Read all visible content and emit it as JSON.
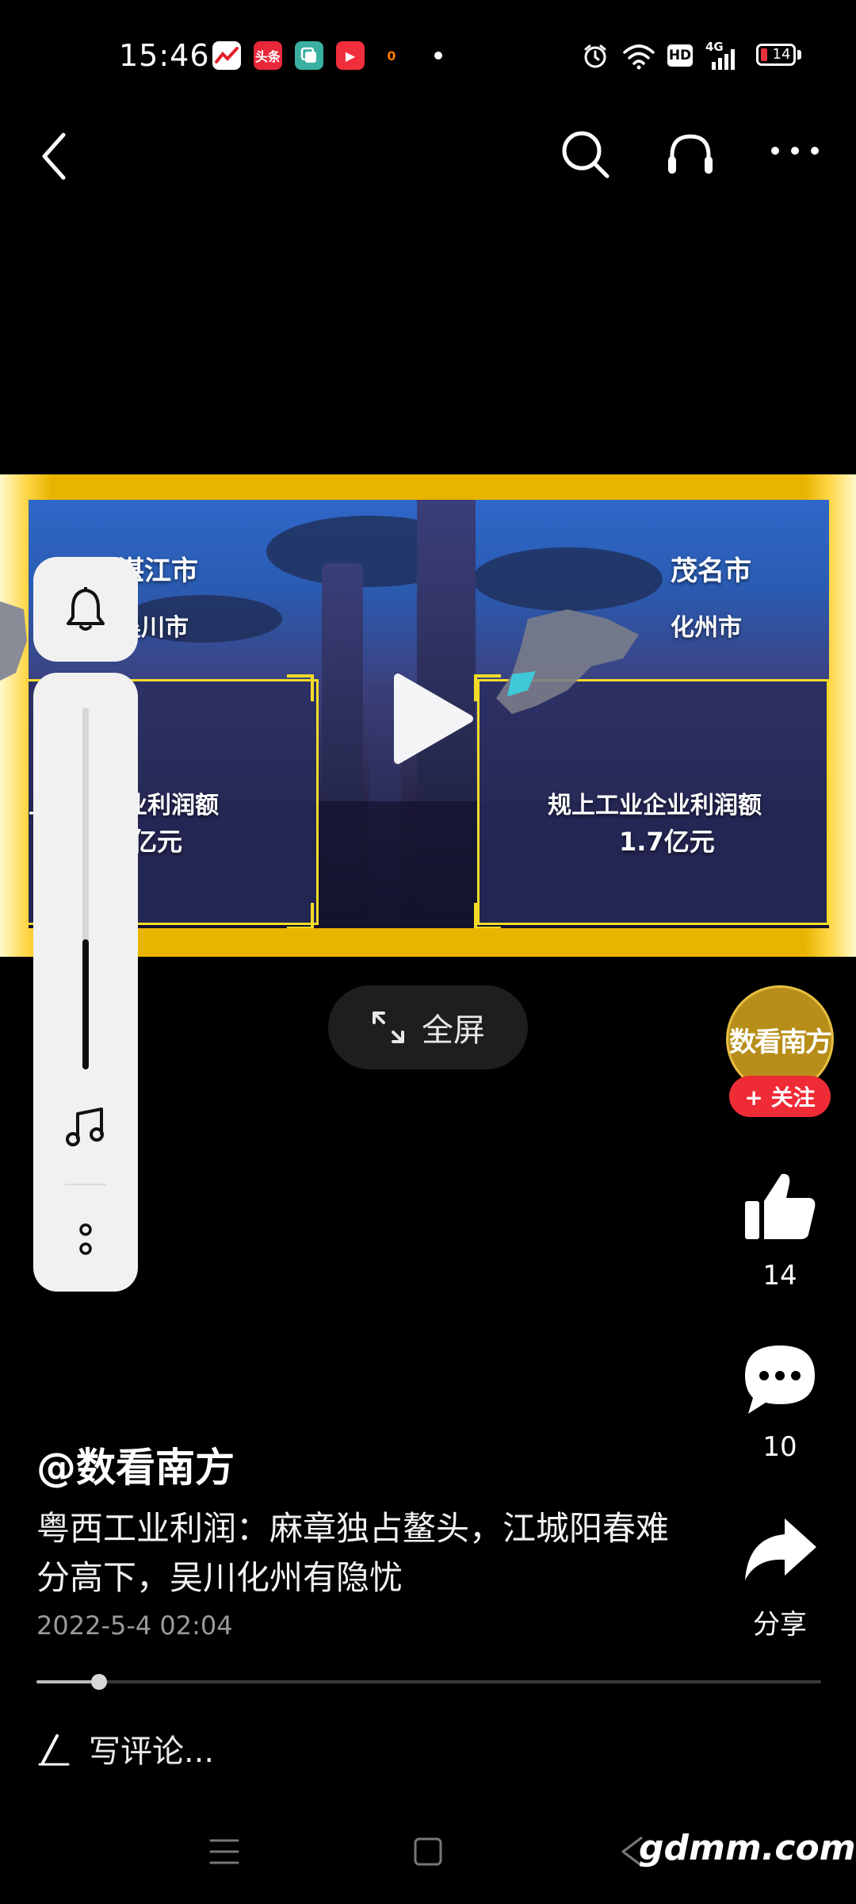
{
  "status_bar": {
    "time": "15:46",
    "apps": [
      {
        "name": "stock-app-icon",
        "label": "",
        "bg": "#ffffff",
        "fg": "#e0202a"
      },
      {
        "name": "toutiao-app-icon",
        "label": "头条",
        "bg": "#e8283a",
        "fg": "#ffffff"
      },
      {
        "name": "multi-window-app-icon",
        "label": "",
        "bg": "#3ab0a0",
        "fg": "#ffffff"
      },
      {
        "name": "video-app-icon",
        "label": "▶",
        "bg": "#f02e3c",
        "fg": "#ffffff"
      },
      {
        "name": "orange-app-icon",
        "label": "0",
        "bg": "#000000",
        "fg": "#ff7a00"
      }
    ],
    "network": "4G",
    "hd": "HD",
    "battery": "14"
  },
  "video": {
    "left_city": "湛江市",
    "left_county": "吴川市",
    "left_metric": "规上工业企业利润额",
    "left_value": "亿元",
    "right_city": "茂名市",
    "right_county": "化州市",
    "right_metric": "规上工业企业利润额",
    "right_value": "1.7亿元"
  },
  "fullscreen_label": "全屏",
  "rail": {
    "avatar_text": "数看南方",
    "follow_label": "+ 关注",
    "like_count": "14",
    "comment_count": "10",
    "share_label": "分享"
  },
  "post": {
    "author": "@数看南方",
    "caption": "粤西工业利润：麻章独占鳌头，江城阳春难分高下，吴川化州有隐忧",
    "date": "2022-5-4 02:04"
  },
  "progress": 0.08,
  "volume_level": 0.36,
  "comment_placeholder": "写评论...",
  "watermark": "gdmm.com",
  "colors": {
    "accent_red": "#ef2b36",
    "frame_gold": "#e9b400",
    "background": "#000000"
  }
}
